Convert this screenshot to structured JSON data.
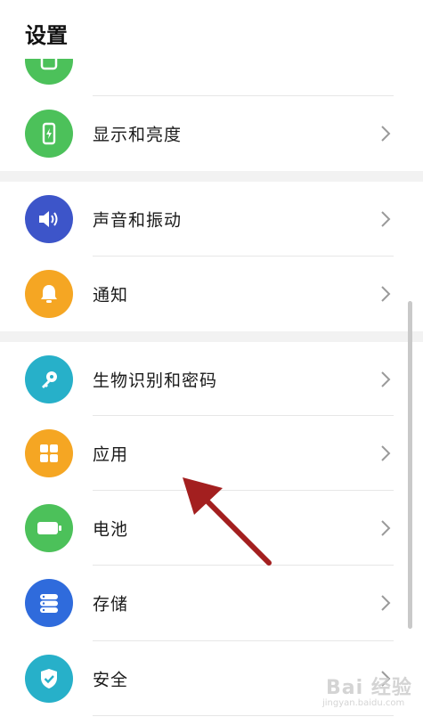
{
  "header": {
    "title": "设置"
  },
  "rows": [
    {
      "label": "",
      "icon": "partial-green-icon",
      "color": "#4cc15a"
    },
    {
      "label": "显示和亮度",
      "icon": "phone-brightness-icon",
      "color": "#4cc15a"
    },
    {
      "label": "声音和振动",
      "icon": "speaker-icon",
      "color": "#3d55c9"
    },
    {
      "label": "通知",
      "icon": "bell-icon",
      "color": "#f5a623"
    },
    {
      "label": "生物识别和密码",
      "icon": "key-icon",
      "color": "#27b0c9"
    },
    {
      "label": "应用",
      "icon": "apps-grid-icon",
      "color": "#f5a623"
    },
    {
      "label": "电池",
      "icon": "battery-icon",
      "color": "#4cc15a"
    },
    {
      "label": "存储",
      "icon": "storage-icon",
      "color": "#2f6bdc"
    },
    {
      "label": "安全",
      "icon": "shield-icon",
      "color": "#27b0c9"
    }
  ],
  "watermark": {
    "brand": "Bai 经验",
    "sub": "jingyan.baidu.com"
  },
  "colors": {
    "arrow": "#a31f1f"
  }
}
